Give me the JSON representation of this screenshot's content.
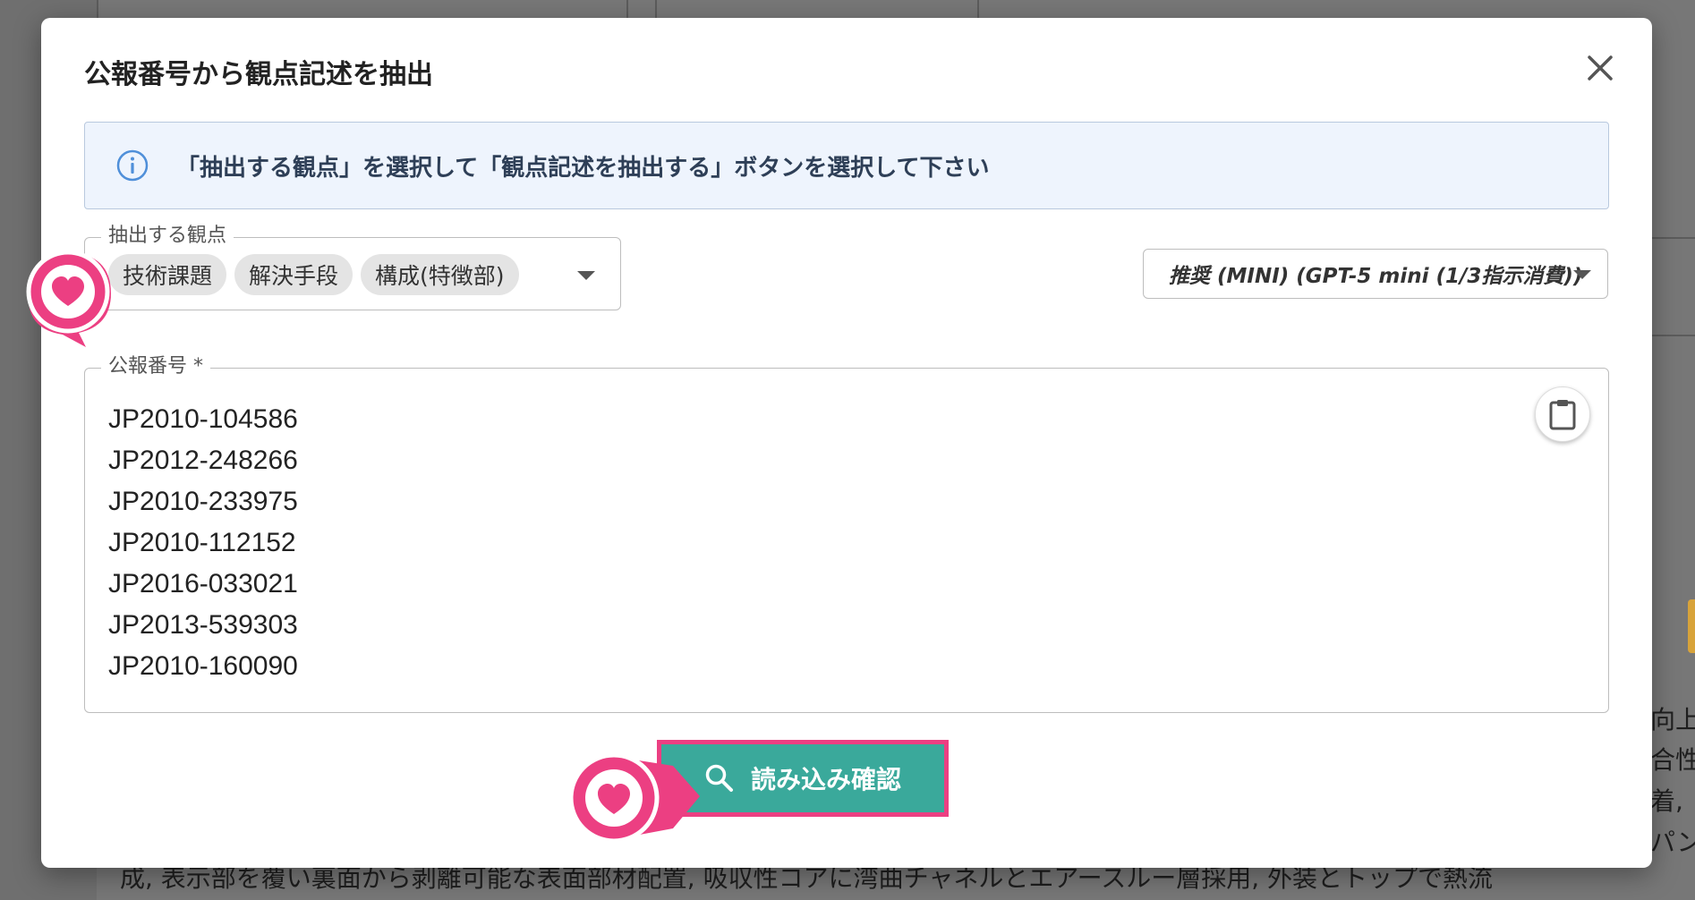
{
  "background": {
    "bottom_text": "成, 表示部を覆い裏面から剥離可能な表面部材配置, 吸収性コアに湾曲チャネルとエアースルー層採用, 外装とトップで熱流",
    "side_lines": [
      "向上",
      "合性",
      "着,",
      "パン"
    ]
  },
  "dialog": {
    "title": "公報番号から観点記述を抽出",
    "info_text": "「抽出する観点」を選択して「観点記述を抽出する」ボタンを選択して下さい",
    "aspect_field": {
      "legend": "抽出する観点",
      "chips": [
        "技術課題",
        "解決手段",
        "構成(特徴部)"
      ]
    },
    "model_select": {
      "selected": "推奨 (MINI) (GPT-5 mini (1/3指示消費))"
    },
    "publication_field": {
      "legend": "公報番号 *",
      "numbers": [
        "JP2010-104586",
        "JP2012-248266",
        "JP2010-233975",
        "JP2010-112152",
        "JP2016-033021",
        "JP2013-539303",
        "JP2010-160090"
      ]
    },
    "load_button": {
      "label": "読み込み確認"
    }
  },
  "icons": {
    "close": "close-icon",
    "info": "info-icon",
    "paste": "clipboard-icon",
    "search": "search-icon",
    "marker": "heart-icon"
  },
  "colors": {
    "accent_button": "#3aa99b",
    "marker_pink": "#ec3f82",
    "info_bg": "#eef4fd"
  }
}
